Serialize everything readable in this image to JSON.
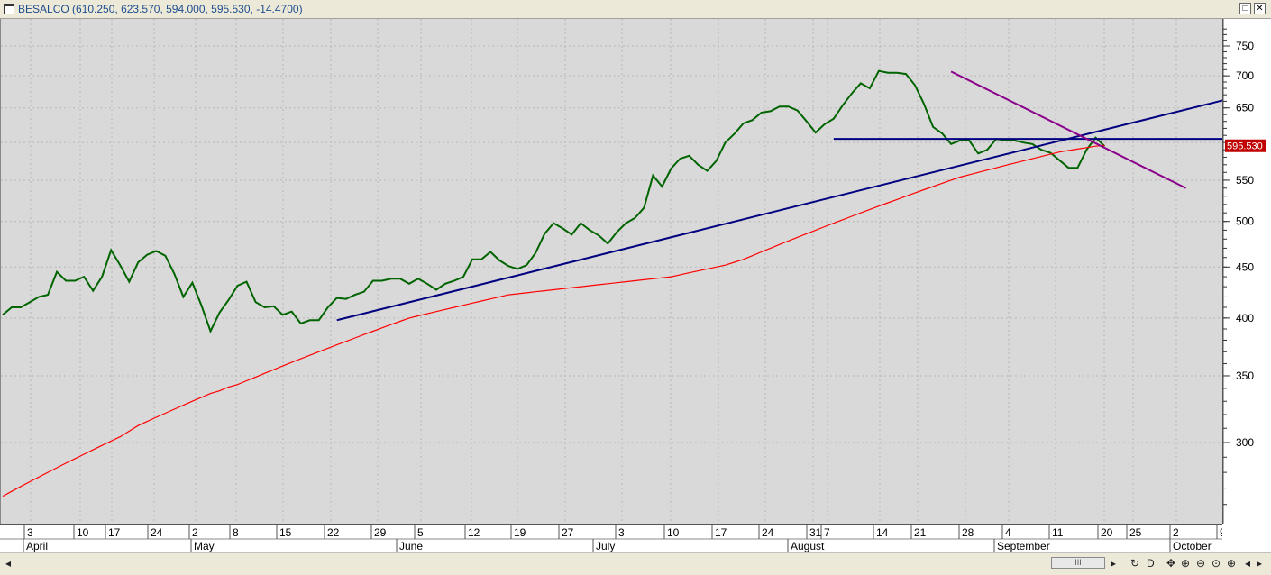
{
  "window": {
    "title": "BESALCO (610.250, 623.570, 594.000, 595.530, -14.4700)",
    "restore_label": "□",
    "close_label": "✕"
  },
  "scrollbar": {
    "left_arrow": "◂",
    "thumb_label": "III",
    "buttons": [
      "▸",
      "↻",
      "D",
      "✥",
      "⊕",
      "⊖",
      "⊙",
      "⊕",
      "◂",
      "▸"
    ]
  },
  "colors": {
    "price": "#006400",
    "ma": "#ff0000",
    "trendline_blue": "#000080",
    "trendline_purple": "#8b008b",
    "last_price_label_bg": "#c00000"
  },
  "chart_data": {
    "type": "line",
    "title": "BESALCO",
    "y_scale": "log",
    "ylim": [
      255,
      790
    ],
    "y_ticks": [
      300,
      350,
      400,
      450,
      500,
      550,
      600,
      650,
      700,
      750
    ],
    "y_tick_labels": [
      "300",
      "350",
      "400",
      "450",
      "500",
      "550",
      "650",
      "700",
      "750"
    ],
    "last_value_label": "595.530",
    "last_value": 595.53,
    "x_tick_labels": [
      "3",
      "10",
      "17",
      "24",
      "2",
      "8",
      "15",
      "22",
      "29",
      "5",
      "12",
      "19",
      "27",
      "3",
      "10",
      "17",
      "24",
      "31",
      "7",
      "14",
      "21",
      "28",
      "4",
      "11",
      "20",
      "25",
      "2",
      "9"
    ],
    "month_labels": [
      "April",
      "May",
      "June",
      "July",
      "August",
      "September",
      "October"
    ],
    "series": [
      {
        "name": "BESALCO",
        "kind": "price",
        "values": [
          403,
          410,
          410,
          415,
          420,
          422,
          445,
          436,
          436,
          440,
          426,
          440,
          468,
          452,
          435,
          455,
          463,
          467,
          462,
          443,
          420,
          434,
          412,
          388,
          405,
          417,
          431,
          435,
          415,
          410,
          411,
          403,
          406,
          395,
          398,
          398,
          410,
          419,
          418,
          422,
          425,
          436,
          436,
          438,
          438,
          433,
          438,
          433,
          427,
          433,
          436,
          440,
          458,
          458,
          466,
          457,
          451,
          448,
          452,
          465,
          486,
          498,
          492,
          485,
          498,
          490,
          484,
          475,
          488,
          498,
          504,
          516,
          556,
          542,
          565,
          578,
          582,
          570,
          562,
          575,
          600,
          612,
          627,
          632,
          643,
          645,
          652,
          652,
          646,
          630,
          614,
          626,
          634,
          654,
          672,
          688,
          680,
          708,
          705,
          705,
          703,
          685,
          656,
          622,
          613,
          598,
          603,
          603,
          585,
          590,
          605,
          603,
          603,
          600,
          598,
          590,
          586,
          576,
          566,
          566,
          590,
          607,
          595
        ]
      },
      {
        "name": "MA",
        "kind": "moving-average",
        "values": [
          265,
          268,
          271,
          274,
          277,
          280,
          283,
          286,
          289,
          292,
          295,
          298,
          301,
          304,
          308,
          312,
          315,
          318,
          321,
          324,
          327,
          330,
          333,
          336,
          338,
          341,
          343,
          346,
          349,
          352,
          355,
          358,
          361,
          364,
          367,
          370,
          373,
          376,
          379,
          382,
          385,
          388,
          391,
          394,
          397,
          400,
          402,
          404,
          406,
          408,
          410,
          412,
          414,
          416,
          418,
          420,
          422,
          423,
          424,
          425,
          426,
          427,
          428,
          429,
          430,
          431,
          432,
          433,
          434,
          435,
          436,
          437,
          438,
          439,
          440,
          442,
          444,
          446,
          448,
          450,
          452,
          455,
          458,
          462,
          466,
          470,
          474,
          478,
          482,
          486,
          490,
          494,
          498,
          502,
          506,
          510,
          514,
          518,
          522,
          526,
          530,
          534,
          538,
          542,
          546,
          550,
          554,
          557,
          560,
          563,
          566,
          569,
          572,
          575,
          578,
          581,
          584,
          587,
          589,
          591,
          593,
          595,
          596
        ]
      }
    ],
    "trendlines": [
      {
        "name": "rising support",
        "color": "blue",
        "from": [
          37,
          398
        ],
        "to": [
          137,
          668
        ]
      },
      {
        "name": "horizontal",
        "color": "blue",
        "from": [
          92,
          605
        ],
        "to": [
          140,
          605
        ]
      },
      {
        "name": "falling",
        "color": "purple",
        "from": [
          105,
          707
        ],
        "to": [
          131,
          540
        ]
      }
    ],
    "grid": true,
    "legend": "none"
  }
}
